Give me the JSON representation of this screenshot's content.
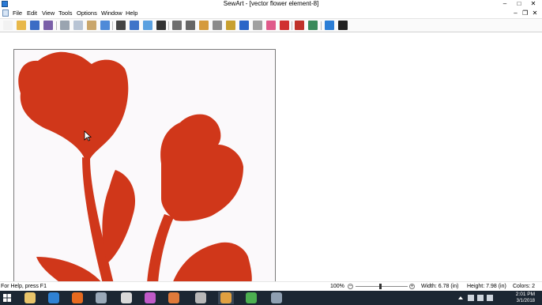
{
  "window": {
    "title": "SewArt - [vector flower element-8]",
    "buttons": [
      "–",
      "□",
      "✕"
    ]
  },
  "menu": {
    "items": [
      "File",
      "Edit",
      "View",
      "Tools",
      "Options",
      "Window",
      "Help"
    ],
    "mdi_buttons": [
      "–",
      "❐",
      "✕"
    ]
  },
  "toolbar": {
    "icons": [
      {
        "name": "new-icon",
        "color": "#f2f2f2"
      },
      {
        "name": "open-icon",
        "color": "#e8b84a"
      },
      {
        "name": "save-icon",
        "color": "#3b6cc5"
      },
      {
        "name": "save-as-icon",
        "color": "#7a5fa8"
      },
      {
        "name": "cut-icon",
        "color": "#9aa4b0"
      },
      {
        "name": "copy-icon",
        "color": "#b8c4d4"
      },
      {
        "name": "paste-icon",
        "color": "#c9a66b"
      },
      {
        "name": "undo-icon",
        "color": "#4f8ad8"
      },
      {
        "name": "adjust-icon",
        "color": "#444444"
      },
      {
        "name": "transform-icon",
        "color": "#3f74c9"
      },
      {
        "name": "resize-icon",
        "color": "#5aa0e0"
      },
      {
        "name": "crop-icon",
        "color": "#333333"
      },
      {
        "name": "stamp-icon",
        "color": "#6e6e6e"
      },
      {
        "name": "wand-icon",
        "color": "#666666"
      },
      {
        "name": "palette-icon",
        "color": "#d59a3c"
      },
      {
        "name": "merge-icon",
        "color": "#8b8b8b"
      },
      {
        "name": "pencil-icon",
        "color": "#c8a030"
      },
      {
        "name": "line-icon",
        "color": "#2a66c8"
      },
      {
        "name": "fill-icon",
        "color": "#a0a0a0"
      },
      {
        "name": "eraser-icon",
        "color": "#e05a8a"
      },
      {
        "name": "color-replace-icon",
        "color": "#d03030"
      },
      {
        "name": "stitch-icon",
        "color": "#c0322a"
      },
      {
        "name": "preview-icon",
        "color": "#3a8a5a"
      },
      {
        "name": "globe-help-icon",
        "color": "#2c7ed6"
      },
      {
        "name": "context-help-icon",
        "color": "#222222"
      }
    ]
  },
  "design": {
    "fill": "#d0371a",
    "background": "#fbf9fb"
  },
  "status": {
    "help": "For Help, press F1",
    "zoom": "100%",
    "width": "Width: 6.78 (in)",
    "height": "Height: 7.98 (in)",
    "colors": "Colors: 2"
  },
  "taskbar": {
    "apps": [
      {
        "name": "file-explorer-icon",
        "color": "#e9c46a"
      },
      {
        "name": "edge-icon",
        "color": "#2f82d4"
      },
      {
        "name": "firefox-icon",
        "color": "#e66a1f"
      },
      {
        "name": "media-icon",
        "color": "#9aa9b8"
      },
      {
        "name": "clock-app-icon",
        "color": "#d9d9d9"
      },
      {
        "name": "photos-icon",
        "color": "#c05ac8"
      },
      {
        "name": "paint-icon",
        "color": "#e07a3a"
      },
      {
        "name": "scanner-icon",
        "color": "#b8b8b8"
      },
      {
        "name": "sewart-taskbar-icon",
        "color": "#e0a040"
      },
      {
        "name": "chrome-icon",
        "color": "#4caf50"
      },
      {
        "name": "monitor-icon",
        "color": "#8fa0b2"
      }
    ],
    "time": "2:01 PM",
    "date": "3/1/2018"
  }
}
